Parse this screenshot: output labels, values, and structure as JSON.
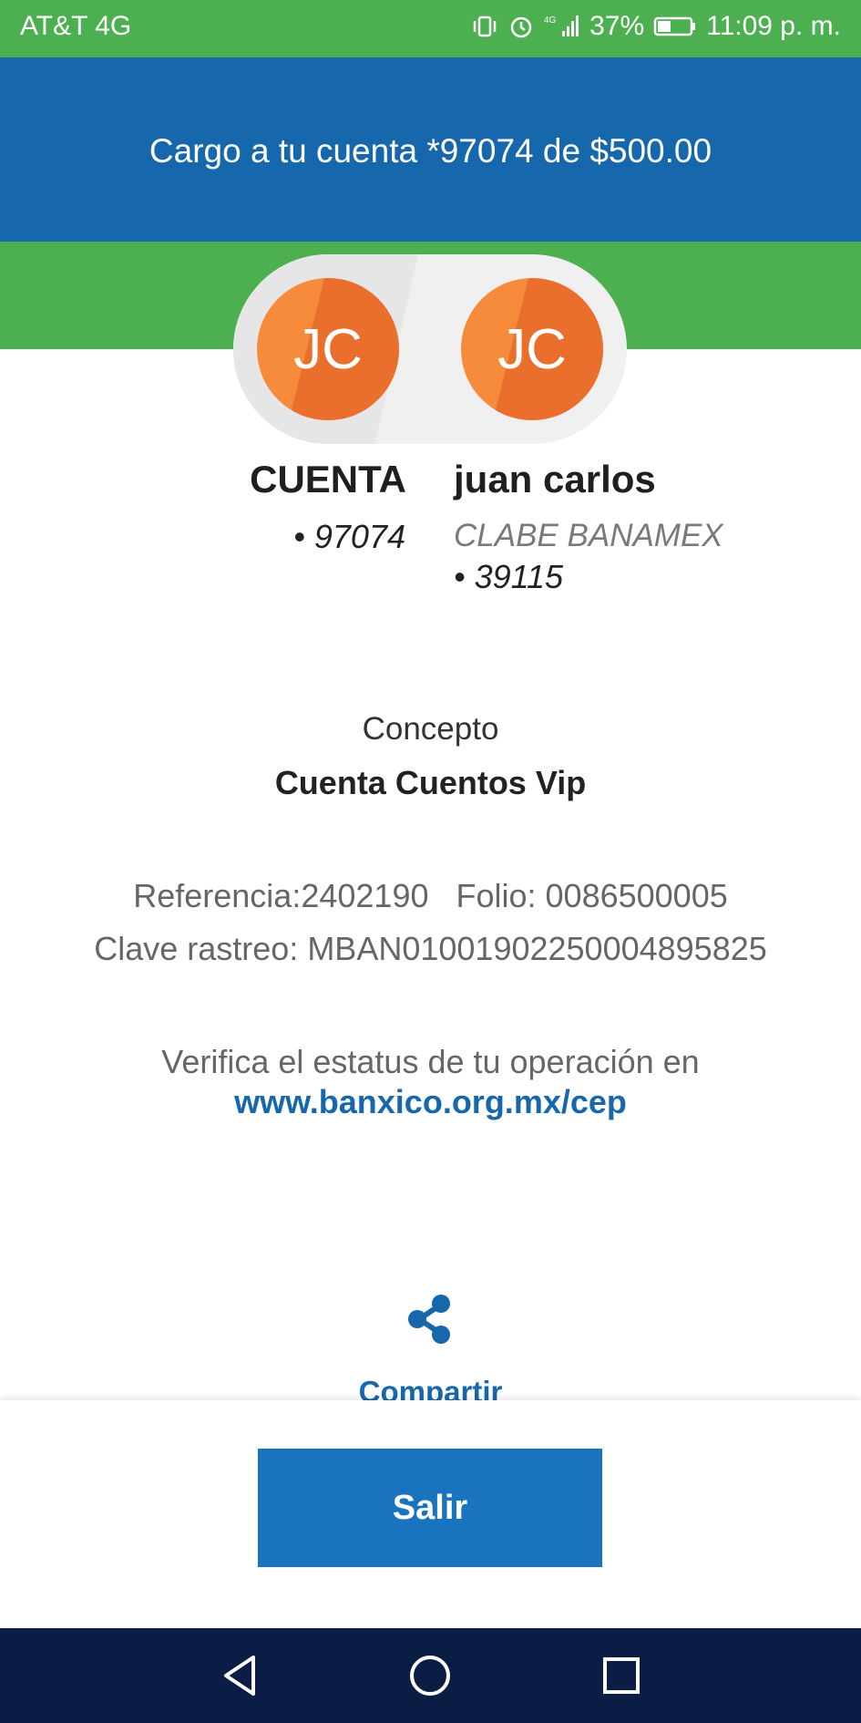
{
  "status_bar": {
    "carrier": "AT&T 4G",
    "battery": "37%",
    "time": "11:09 p. m.",
    "icons": [
      "vibrate-icon",
      "alarm-icon",
      "signal-icon",
      "battery-icon"
    ]
  },
  "header": {
    "title": "Cargo a tu cuenta *97074 de $500.00"
  },
  "from_account": {
    "initials": "JC",
    "name": "CUENTA",
    "number": "• 97074"
  },
  "to_account": {
    "initials": "JC",
    "name": "juan carlos",
    "bank": "CLABE BANAMEX",
    "number": "• 39115"
  },
  "concept": {
    "label": "Concepto",
    "value": "Cuenta Cuentos Vip"
  },
  "details": {
    "reference": "Referencia:2402190",
    "folio": "Folio: 0086500005",
    "tracking": "Clave rastreo: MBAN01001902250004895825"
  },
  "verify": {
    "text": "Verifica el estatus de tu operación en",
    "link": "www.banxico.org.mx/cep"
  },
  "share": {
    "label": "Compartir",
    "icon": "share-icon"
  },
  "exit_button": {
    "label": "Salir"
  },
  "nav_bar": {
    "buttons": [
      "back-icon",
      "home-icon",
      "recents-icon"
    ]
  },
  "colors": {
    "green": "#4caf50",
    "blue_header": "#1767ac",
    "orange_avatar": "#f68c3b",
    "nav_bar": "#0b1d45",
    "button": "#1a73be"
  }
}
